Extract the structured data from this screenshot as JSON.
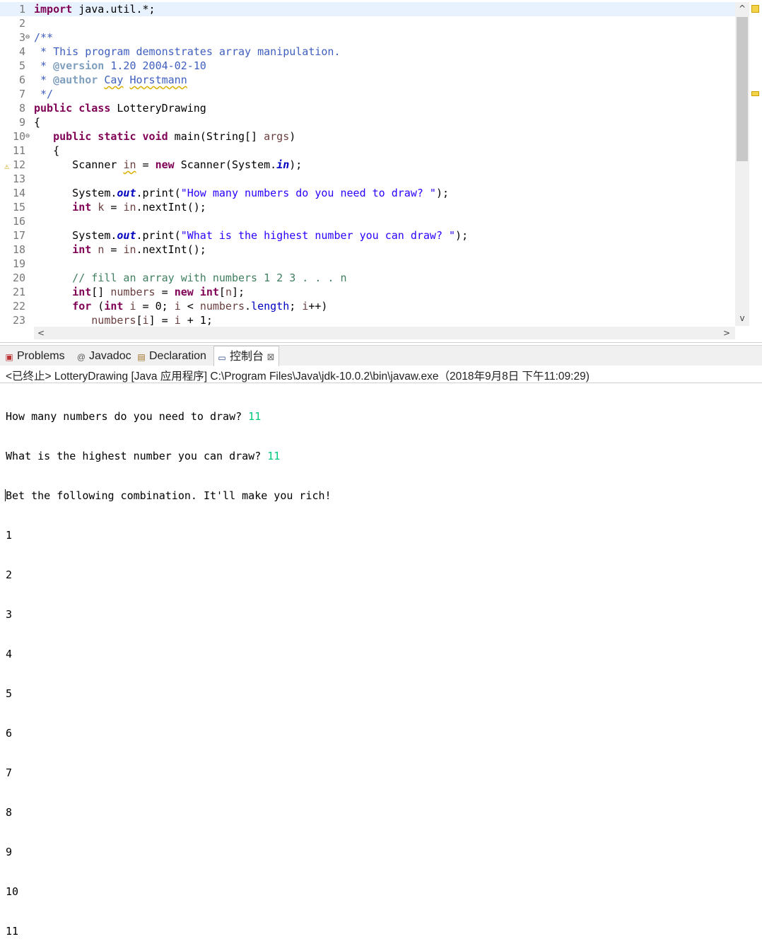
{
  "editor": {
    "line_numbers": [
      "1",
      "2",
      "3",
      "4",
      "5",
      "6",
      "7",
      "8",
      "9",
      "10",
      "11",
      "12",
      "13",
      "14",
      "15",
      "16",
      "17",
      "18",
      "19",
      "20",
      "21",
      "22",
      "23"
    ],
    "fold_markers": [
      "⊖",
      "⊖"
    ],
    "code": {
      "l1_kw": "import",
      "l1_rest": " java.util.*;",
      "l3": "/**",
      "l4": " * This program demonstrates array manipulation.",
      "l5_star": " * ",
      "l5_tag": "@version",
      "l5_rest": " 1.20 2004-02-10",
      "l6_star": " * ",
      "l6_tag": "@author",
      "l6_sp": " ",
      "l6_w1": "Cay",
      "l6_sp2": " ",
      "l6_w2": "Horstmann",
      "l7": " */",
      "l8_kw": "public class",
      "l8_rest": " LotteryDrawing",
      "l9": "{",
      "l10_ind": "   ",
      "l10_kw": "public static void",
      "l10_a": " main(String[] ",
      "l10_var": "args",
      "l10_b": ")",
      "l11": "   {",
      "l12_a": "      Scanner ",
      "l12_var": "in",
      "l12_b": " = ",
      "l12_kw": "new",
      "l12_c": " Scanner(System.",
      "l12_it": "in",
      "l12_d": ");",
      "l14_a": "      System.",
      "l14_it": "out",
      "l14_b": ".print(",
      "l14_str": "\"How many numbers do you need to draw? \"",
      "l14_c": ");",
      "l15_ind": "      ",
      "l15_kw": "int",
      "l15_a": " ",
      "l15_var": "k",
      "l15_b": " = ",
      "l15_var2": "in",
      "l15_c": ".nextInt();",
      "l17_a": "      System.",
      "l17_it": "out",
      "l17_b": ".print(",
      "l17_str": "\"What is the highest number you can draw? \"",
      "l17_c": ");",
      "l18_ind": "      ",
      "l18_kw": "int",
      "l18_a": " ",
      "l18_var": "n",
      "l18_b": " = ",
      "l18_var2": "in",
      "l18_c": ".nextInt();",
      "l20": "      // fill an array with numbers 1 2 3 . . . n",
      "l21_ind": "      ",
      "l21_kw": "int",
      "l21_a": "[] ",
      "l21_var": "numbers",
      "l21_b": " = ",
      "l21_kw2": "new",
      "l21_c": " ",
      "l21_kw3": "int",
      "l21_d": "[",
      "l21_var2": "n",
      "l21_e": "];",
      "l22_ind": "      ",
      "l22_kw": "for",
      "l22_a": " (",
      "l22_kw2": "int",
      "l22_b": " ",
      "l22_var": "i",
      "l22_c": " = 0; ",
      "l22_var2": "i",
      "l22_d": " < ",
      "l22_var3": "numbers",
      "l22_e": ".",
      "l22_fld": "length",
      "l22_f": "; ",
      "l22_var4": "i",
      "l22_g": "++)",
      "l23_ind": "         ",
      "l23_var": "numbers",
      "l23_a": "[",
      "l23_var2": "i",
      "l23_b": "] = ",
      "l23_var3": "i",
      "l23_c": " + 1;"
    },
    "scroll_up": "^",
    "scroll_down": "v",
    "scroll_left": "<",
    "scroll_right": ">"
  },
  "panel": {
    "tabs": [
      {
        "label": "Problems",
        "icon": "problems-icon"
      },
      {
        "label": "Javadoc",
        "icon": "at-icon"
      },
      {
        "label": "Declaration",
        "icon": "declaration-icon"
      },
      {
        "label": "控制台",
        "icon": "console-icon"
      }
    ],
    "close_glyph": "⊠",
    "status": "<已终止> LotteryDrawing [Java 应用程序] C:\\Program Files\\Java\\jdk-10.0.2\\bin\\javaw.exe（2018年9月8日 下午11:09:29)"
  },
  "console": {
    "prompt1": "How many numbers do you need to draw? ",
    "input1": "11",
    "prompt2": "What is the highest number you can draw? ",
    "input2": "11",
    "line3": "Bet the following combination. It'll make you rich!",
    "numbers": [
      "1",
      "2",
      "3",
      "4",
      "5",
      "6",
      "7",
      "8",
      "9",
      "10",
      "11"
    ]
  },
  "colors": {
    "keyword": "#7f0055",
    "string": "#2a00ff",
    "javadoc": "#3f5fbf",
    "comment": "#3f7f5f",
    "console_input": "#00c87d"
  }
}
